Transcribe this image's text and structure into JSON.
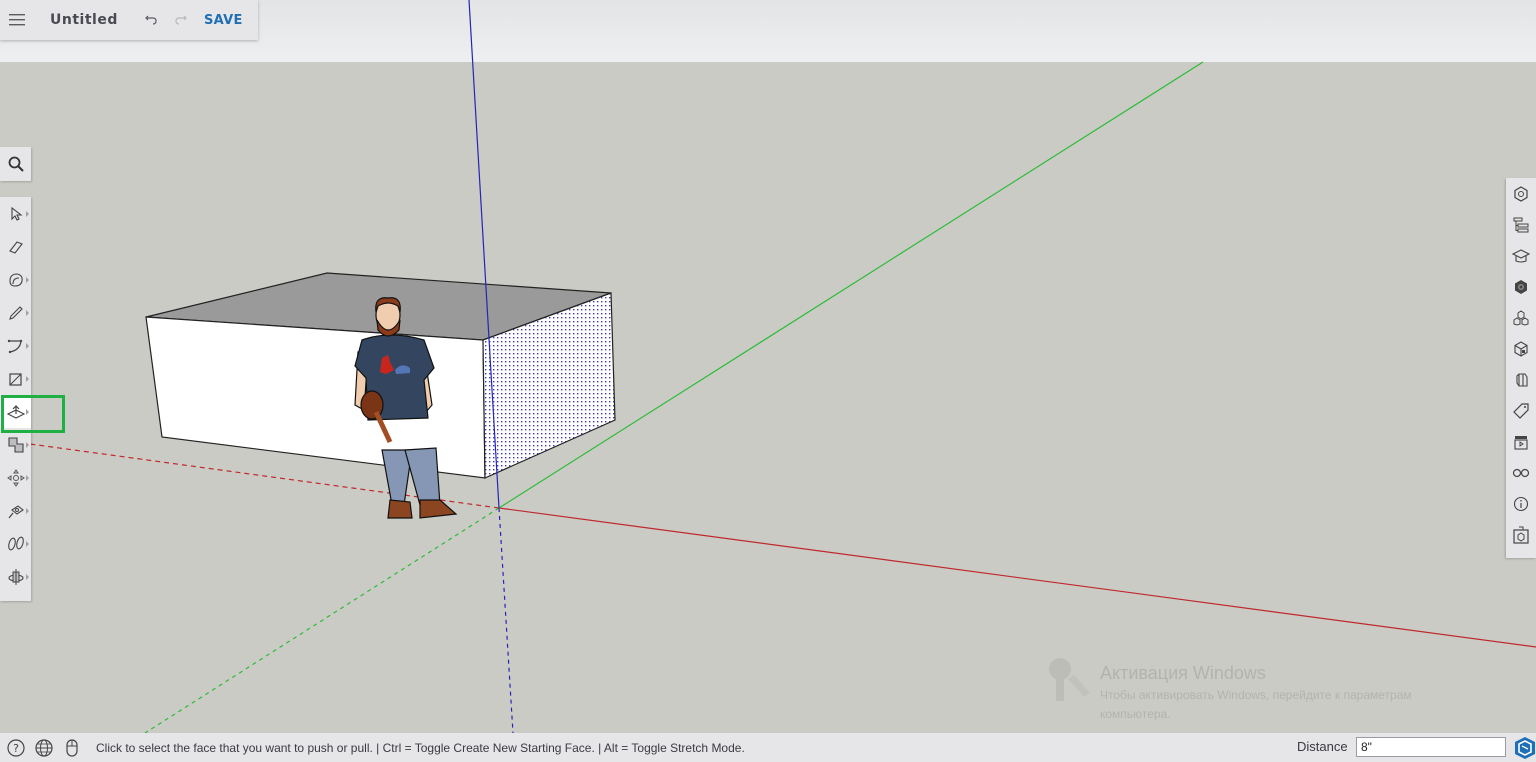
{
  "app": {
    "title": "Untitled",
    "save_label": "SAVE",
    "menu_icon": "hamburger-icon",
    "undo_icon": "undo-icon",
    "redo_icon": "redo-icon"
  },
  "left_toolbar": {
    "search_icon": "search-icon",
    "tools": [
      {
        "name": "select",
        "icon": "cursor-arrow-icon",
        "has_submenu": true
      },
      {
        "name": "eraser",
        "icon": "eraser-icon",
        "has_submenu": false
      },
      {
        "name": "paint-bucket",
        "icon": "paint-bucket-icon",
        "has_submenu": true
      },
      {
        "name": "pencil",
        "icon": "pencil-icon",
        "has_submenu": true
      },
      {
        "name": "arc",
        "icon": "arc-icon",
        "has_submenu": true
      },
      {
        "name": "rectangle",
        "icon": "rectangle-icon",
        "has_submenu": true
      },
      {
        "name": "push-pull",
        "icon": "push-pull-icon",
        "has_submenu": true,
        "active": true,
        "highlighted": true
      },
      {
        "name": "offset",
        "icon": "offset-icon",
        "has_submenu": true
      },
      {
        "name": "move",
        "icon": "move-icon",
        "has_submenu": true
      },
      {
        "name": "tape-measure",
        "icon": "tape-measure-icon",
        "has_submenu": true
      },
      {
        "name": "walk",
        "icon": "footprints-icon",
        "has_submenu": true
      },
      {
        "name": "orbit",
        "icon": "orbit-icon",
        "has_submenu": true
      }
    ],
    "highlight_color": "#1fb043"
  },
  "right_panel": {
    "items": [
      {
        "name": "entity-info",
        "icon": "entity-info-icon"
      },
      {
        "name": "outliner",
        "icon": "outliner-icon"
      },
      {
        "name": "instructor",
        "icon": "graduation-cap-icon"
      },
      {
        "name": "materials",
        "icon": "materials-icon"
      },
      {
        "name": "components",
        "icon": "components-icon"
      },
      {
        "name": "styles",
        "icon": "styles-cube-icon"
      },
      {
        "name": "solid-inspector",
        "icon": "solid-cube-icon"
      },
      {
        "name": "tags",
        "icon": "tag-icon"
      },
      {
        "name": "scenes",
        "icon": "clapperboard-icon"
      },
      {
        "name": "display",
        "icon": "glasses-icon"
      },
      {
        "name": "model-info",
        "icon": "info-icon"
      },
      {
        "name": "3d-warehouse",
        "icon": "warehouse-icon"
      }
    ]
  },
  "viewport": {
    "sky_color": "#e8eaec",
    "ground_color": "#cbcbc6",
    "axis_colors": {
      "red": "#c0282b",
      "green": "#2dbb37",
      "blue": "#2424b8"
    },
    "objects": [
      "box",
      "scale-figure"
    ]
  },
  "status_bar": {
    "help_icon": "help-circle-icon",
    "globe_icon": "globe-icon",
    "mouse_icon": "mouse-icon",
    "message": "Click to select the face that you want to push or pull. | Ctrl = Toggle Create New Starting Face. | Alt = Toggle Stretch Mode.",
    "measurement_label": "Distance",
    "measurement_value": "8\"",
    "logo_icon": "sketchup-logo-icon"
  },
  "watermark": {
    "title": "Активация Windows",
    "line1": "Чтобы активировать Windows, перейдите к параметрам",
    "line2": "компьютера."
  }
}
